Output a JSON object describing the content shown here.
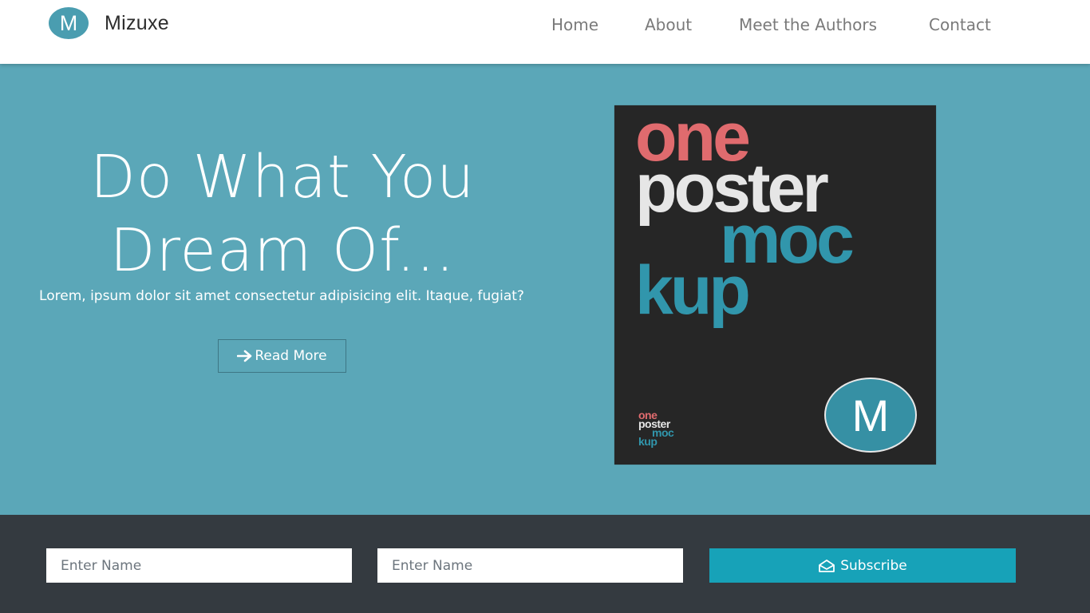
{
  "navbar": {
    "brand_logo_letter": "M",
    "brand_name": "Mizuxe",
    "links": [
      "Home",
      "About",
      "Meet the Authors",
      "Contact"
    ]
  },
  "hero": {
    "title_line1": "Do What You",
    "title_line2": "Dream Of...",
    "subtitle": "Lorem, ipsum dolor sit amet consectetur adipisicing elit. Itaque, fugiat?",
    "read_more_label": "Read More",
    "read_more_icon": "arrow-right-icon"
  },
  "poster": {
    "words": [
      "one",
      "poster",
      "moc",
      "kup"
    ],
    "small_words": [
      "one",
      "poster",
      "moc",
      "kup"
    ],
    "logo_letter": "M",
    "colors": {
      "one": "#e06b6e",
      "poster": "#e6e6e6",
      "mockup": "#3196ac",
      "background": "#262626"
    }
  },
  "subscribe": {
    "name_placeholder_1": "Enter Name",
    "name_placeholder_2": "Enter Name",
    "button_label": "Subscribe",
    "button_icon": "envelope-open-icon"
  },
  "colors": {
    "hero_bg": "#5ba7b8",
    "footer_bg": "#343a40",
    "subscribe_button": "#17a2b8",
    "brand_circle": "#4a9db0"
  }
}
